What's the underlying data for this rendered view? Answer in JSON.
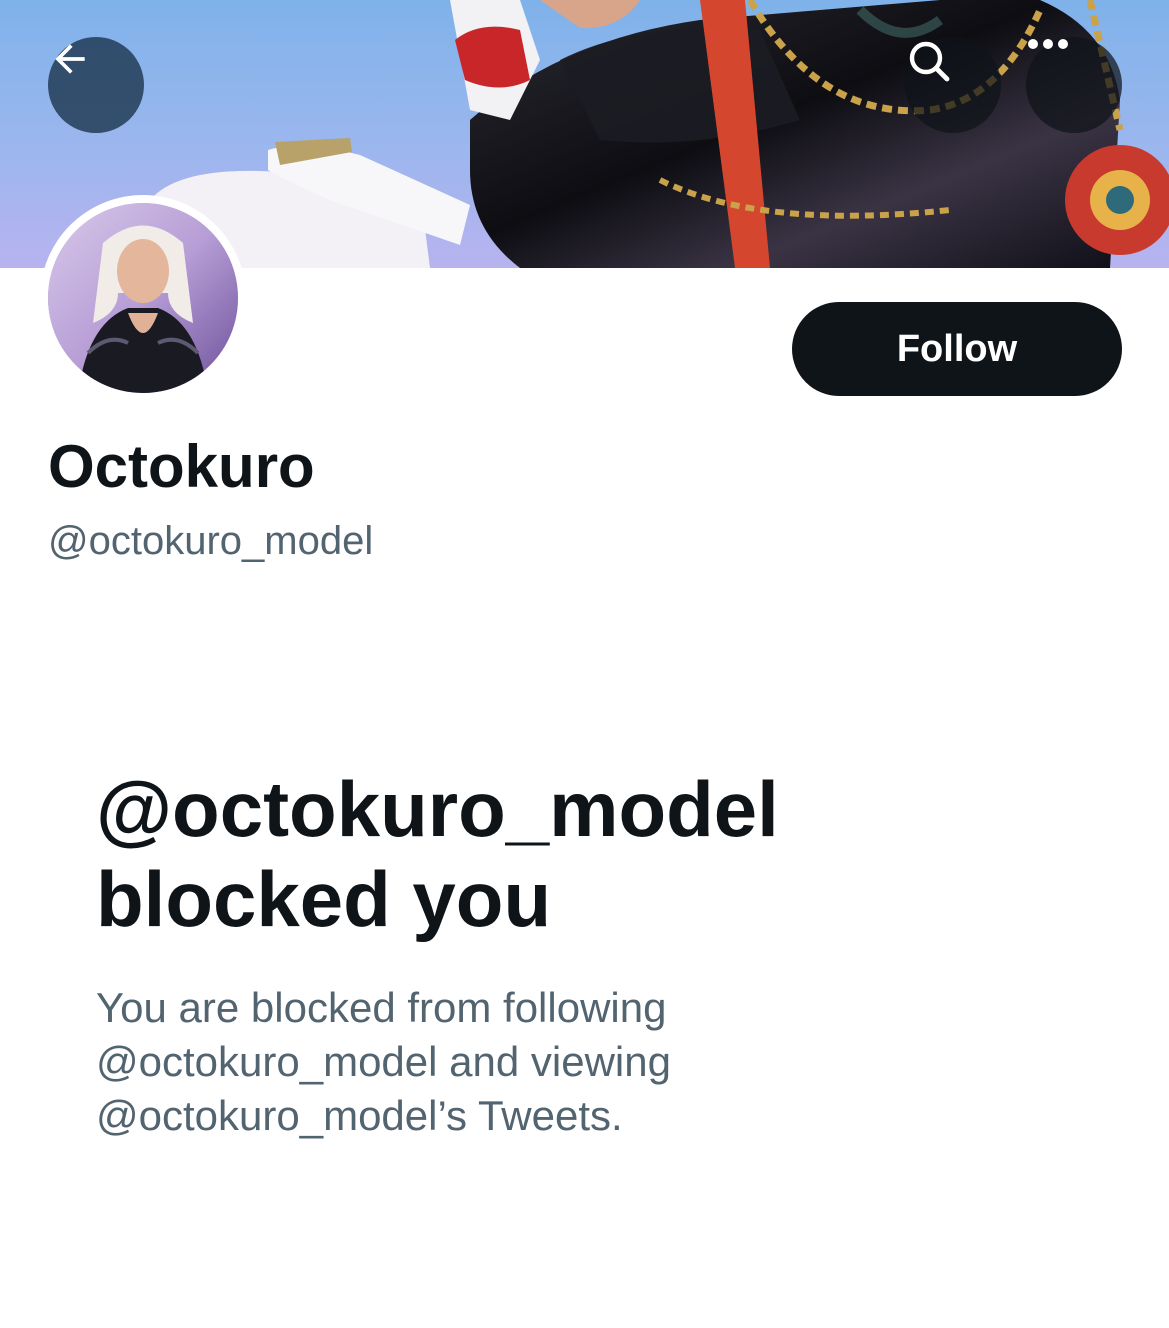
{
  "profile": {
    "display_name": "Octokuro",
    "handle": "@octokuro_model",
    "follow_label": "Follow"
  },
  "blocked": {
    "title_line1": "@octokuro_model",
    "title_line2": "blocked you",
    "desc_line1": "You are blocked from following",
    "desc_line2": "@octokuro_model and viewing",
    "desc_line3": "@octokuro_model’s Tweets."
  },
  "icons": {
    "back": "arrow-left-icon",
    "search": "search-icon",
    "more": "more-horizontal-icon"
  },
  "colors": {
    "primary_text": "#0f1419",
    "secondary_text": "#536471",
    "follow_button": "#0f1419"
  }
}
